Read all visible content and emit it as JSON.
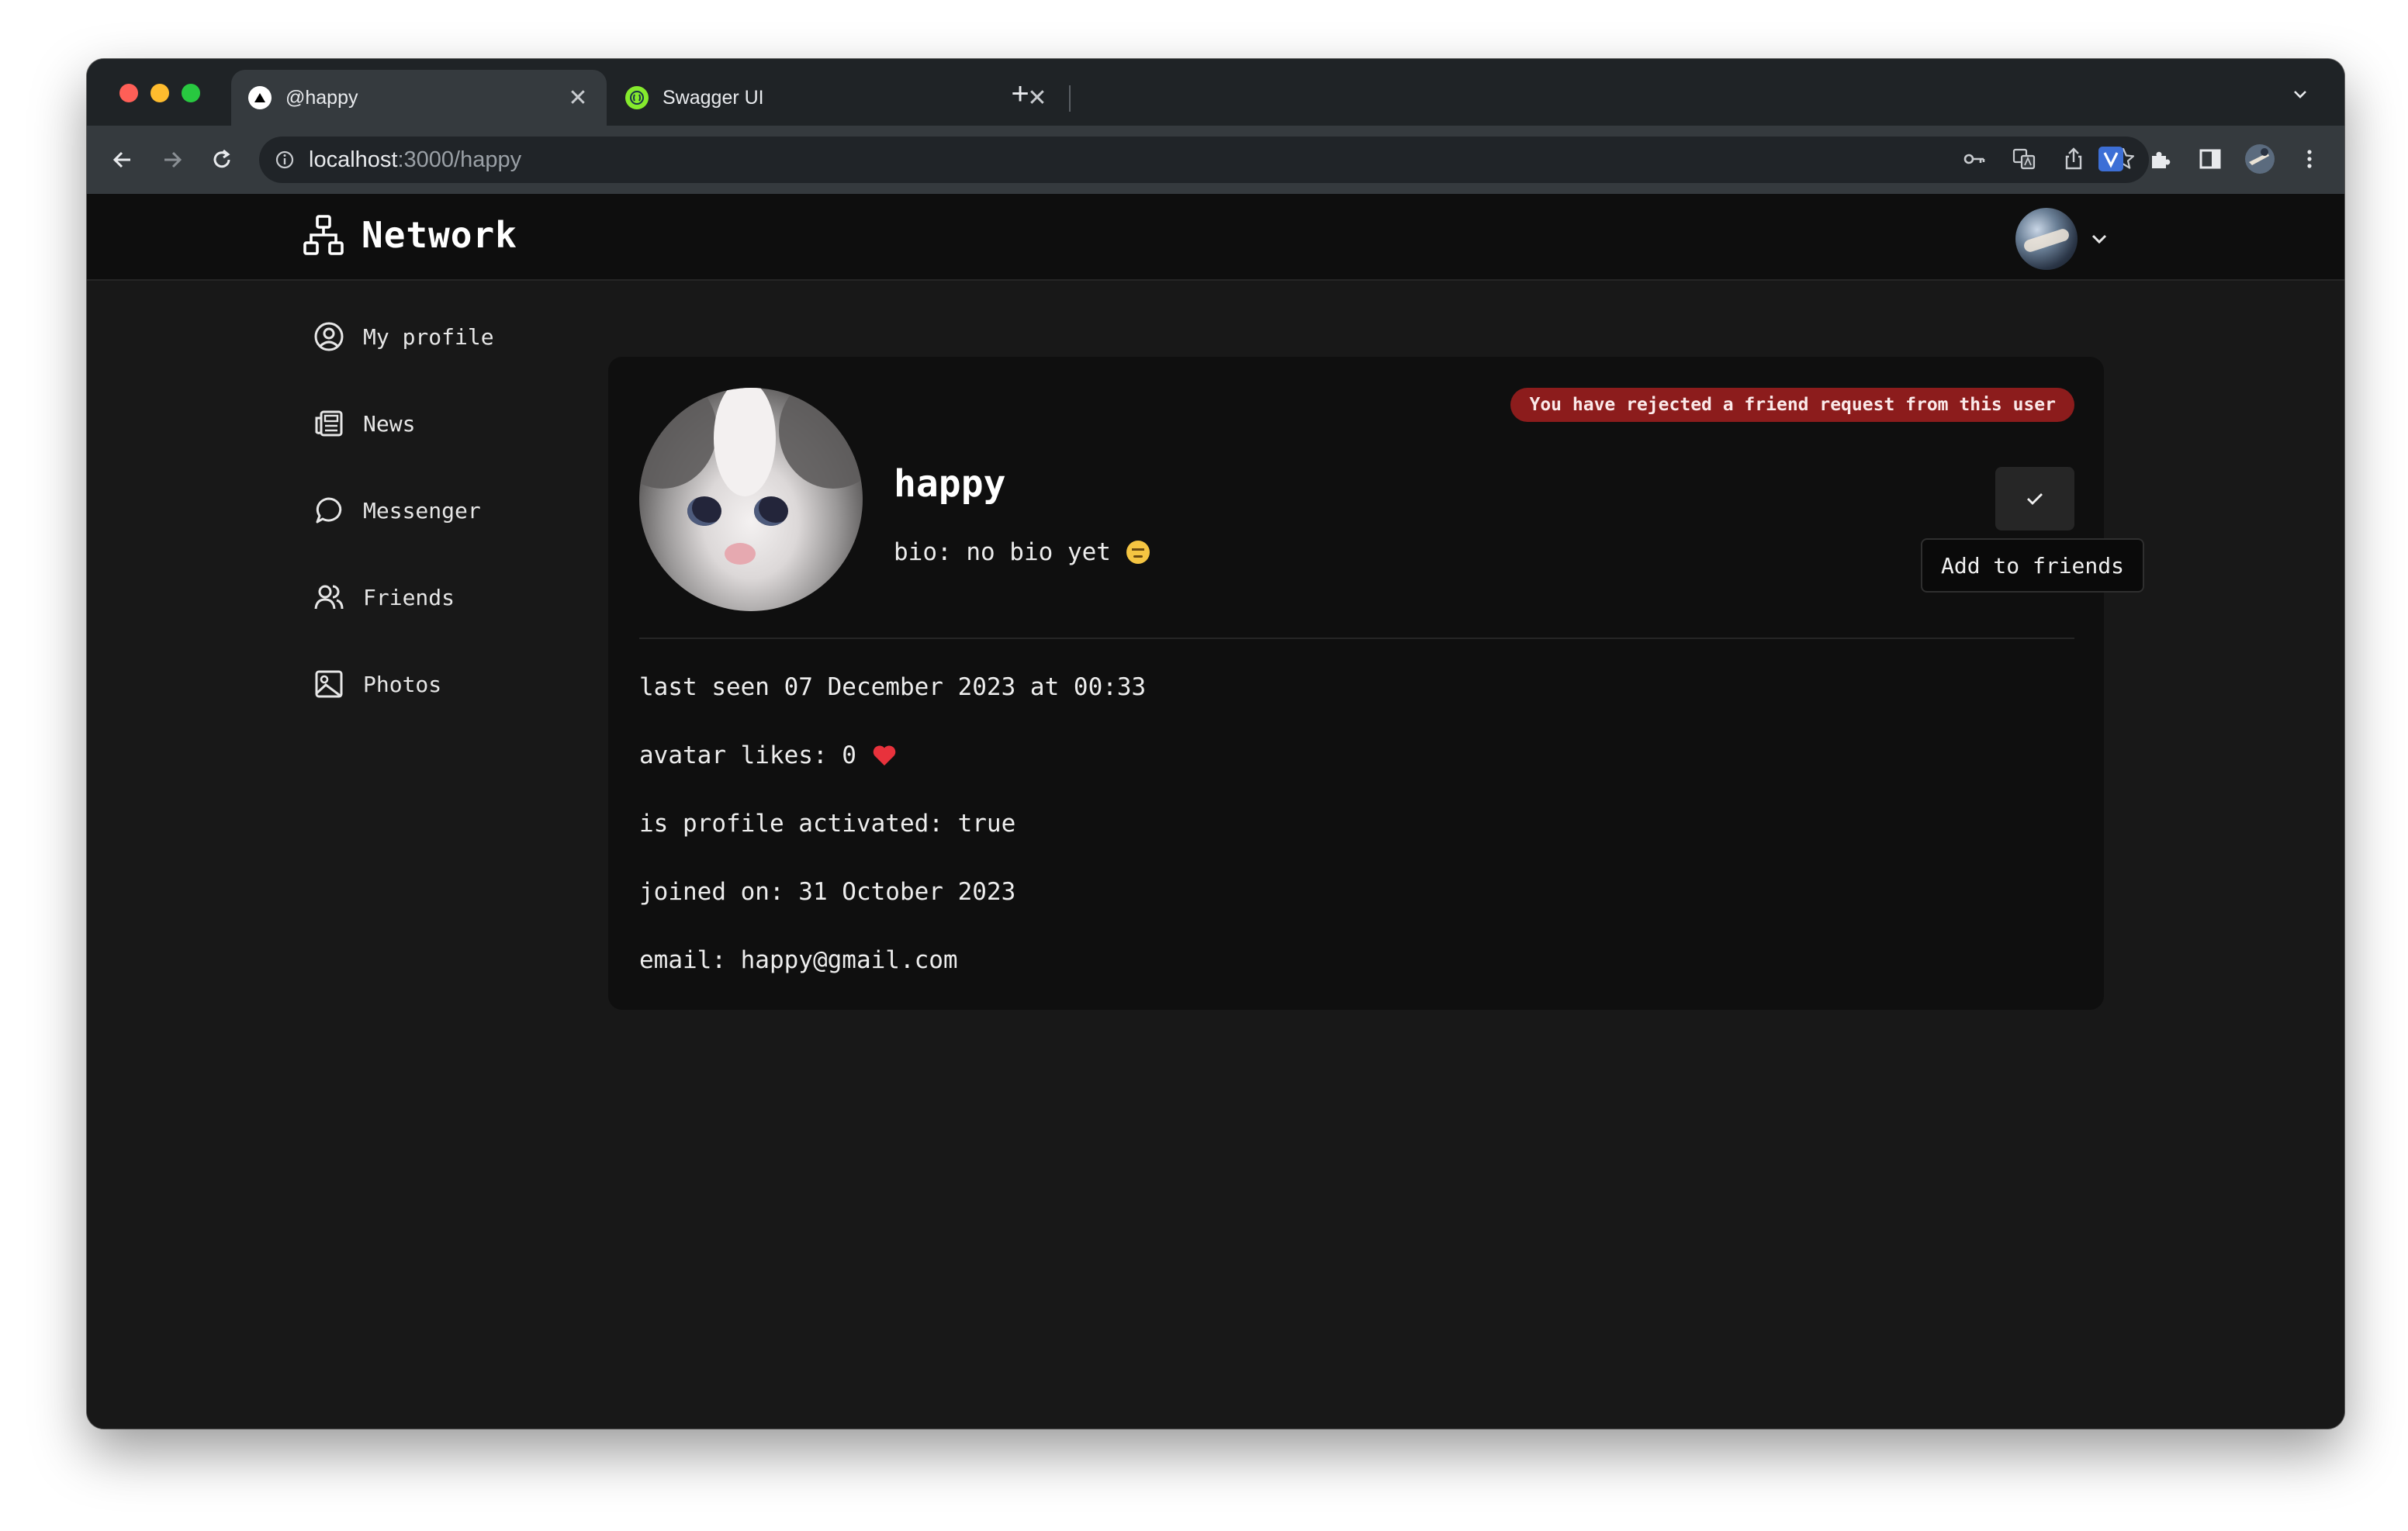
{
  "browser": {
    "tabs": [
      {
        "title": "@happy",
        "active": true,
        "favicon": "vercel-triangle-icon"
      },
      {
        "title": "Swagger UI",
        "active": false,
        "favicon": "swagger-icon"
      }
    ],
    "url_host": "localhost",
    "url_path": ":3000/happy"
  },
  "app": {
    "brand": "Network",
    "nav": [
      {
        "label": "My profile",
        "icon": "user-circle-icon"
      },
      {
        "label": "News",
        "icon": "newspaper-icon"
      },
      {
        "label": "Messenger",
        "icon": "message-icon"
      },
      {
        "label": "Friends",
        "icon": "users-icon"
      },
      {
        "label": "Photos",
        "icon": "image-icon"
      }
    ]
  },
  "profile": {
    "username": "happy",
    "bio": "bio: no bio yet",
    "status_badge": "You have rejected a friend request from this user",
    "add_tooltip": "Add to friends",
    "last_seen": "last seen 07 December 2023 at 00:33",
    "avatar_likes": "avatar likes: 0",
    "activated": "is profile activated: true",
    "joined": "joined on: 31 October 2023",
    "email": "email: happy@gmail.com"
  },
  "colors": {
    "badge_bg": "#8c1c1c",
    "app_bg": "#181818",
    "header_bg": "#0e0e0e",
    "card_bg": "#0f0f0f"
  }
}
